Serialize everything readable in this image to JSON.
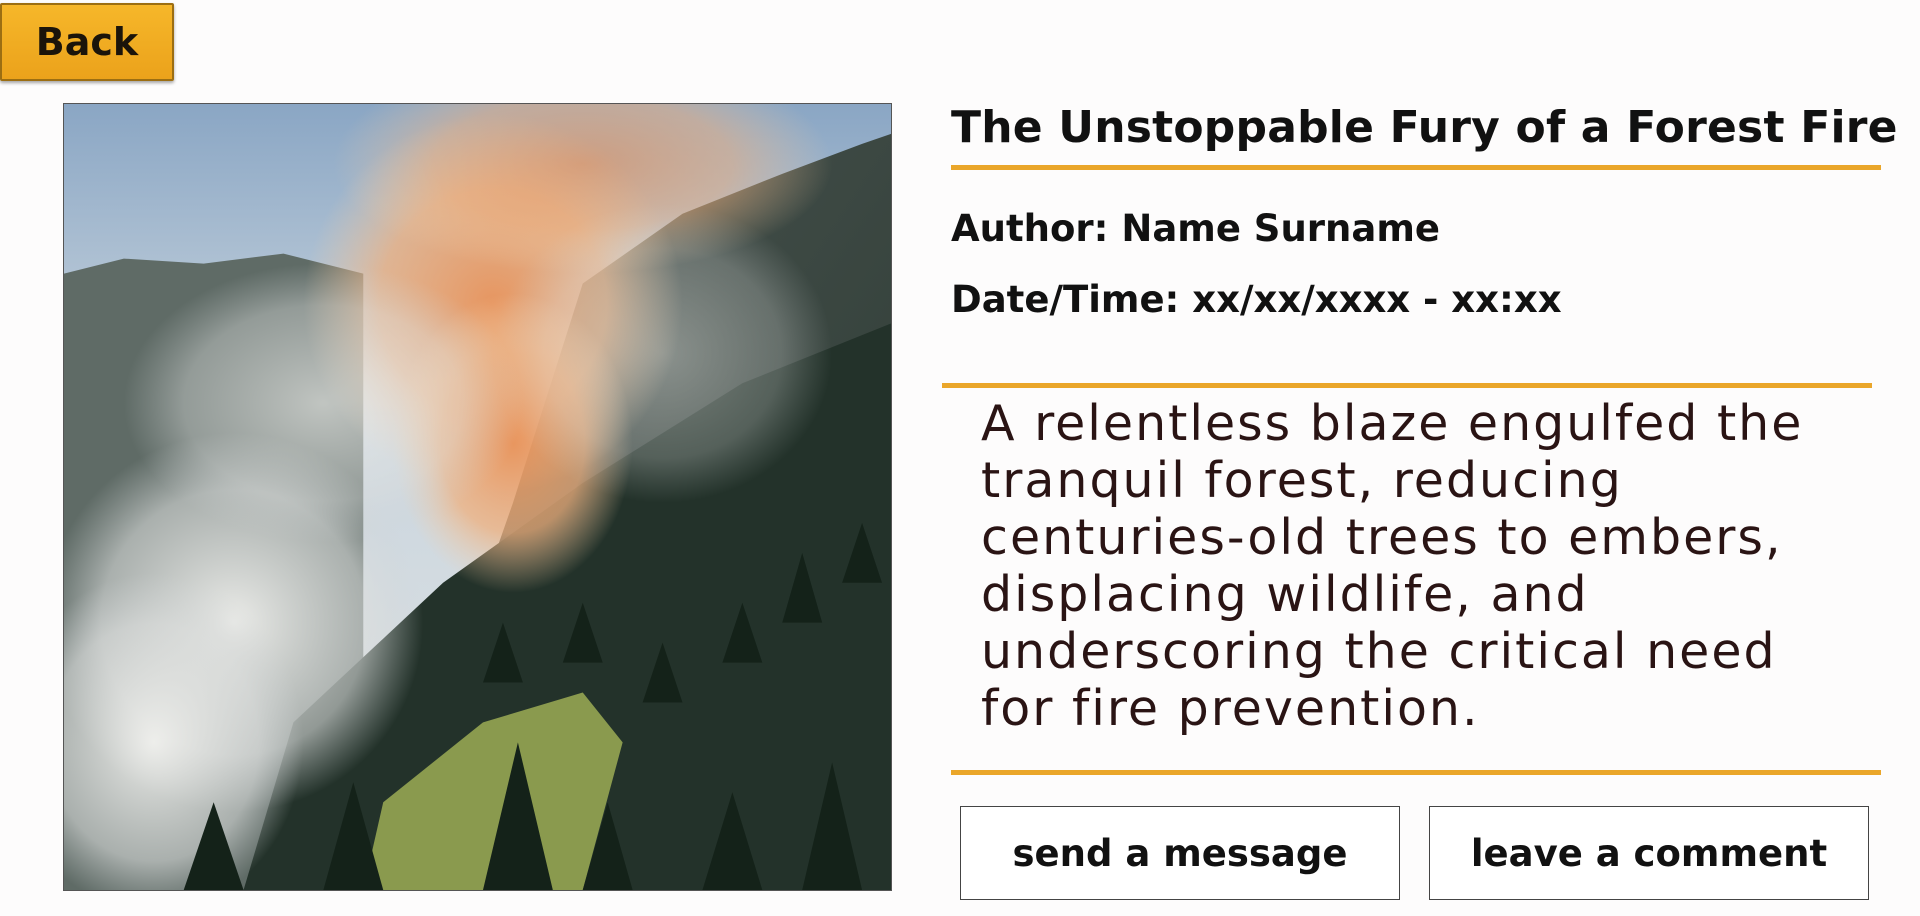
{
  "back_button": {
    "label": "Back"
  },
  "article": {
    "image_alt": "forest-fire-photo",
    "title": "The Unstoppable Fury of a Forest Fire",
    "author": "Author: Name Surname",
    "datetime": "Date/Time: xx/xx/xxxx - xx:xx",
    "summary": "A relentless blaze engulfed the tranquil forest, reducing centuries-old trees to embers, displacing wildlife, and underscoring the critical need for fire prevention."
  },
  "actions": {
    "send_message_label": "send a message",
    "leave_comment_label": "leave a comment"
  },
  "colors": {
    "accent": "#eaa62a",
    "back_button": "#f2ad22",
    "text": "#111111"
  }
}
